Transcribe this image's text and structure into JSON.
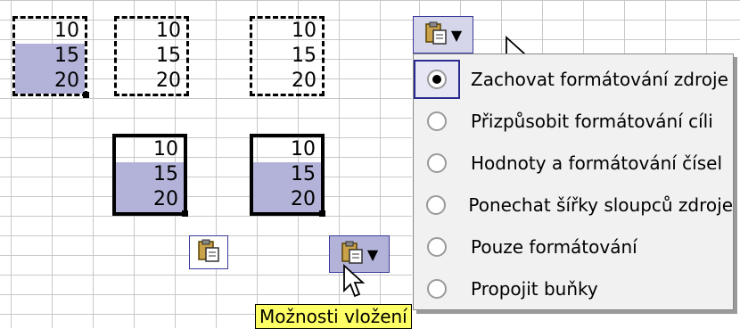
{
  "sheet": {
    "block1": [
      "10",
      "15",
      "20"
    ],
    "block2": [
      "10",
      "15",
      "20"
    ],
    "block3": [
      "10",
      "15",
      "20"
    ],
    "block4": [
      "10",
      "15",
      "20"
    ],
    "block5": [
      "10",
      "15",
      "20"
    ]
  },
  "tooltip": "Možnosti vložení",
  "menu": {
    "items": [
      {
        "label": "Zachovat formátování zdroje",
        "selected": true
      },
      {
        "label": "Přizpůsobit formátování cíli",
        "selected": false
      },
      {
        "label": "Hodnoty a formátování čísel",
        "selected": false
      },
      {
        "label": "Ponechat šířky sloupců zdroje",
        "selected": false
      },
      {
        "label": "Pouze formátování",
        "selected": false
      },
      {
        "label": "Propojit buňky",
        "selected": false
      }
    ]
  },
  "colors": {
    "selection": "#b3b3d9",
    "tooltip_bg": "#ffff66",
    "accent_border": "#3b3b9b"
  },
  "icons": [
    "paste-icon",
    "dropdown-arrow-icon",
    "mouse-cursor-icon",
    "radio-button-icon"
  ]
}
